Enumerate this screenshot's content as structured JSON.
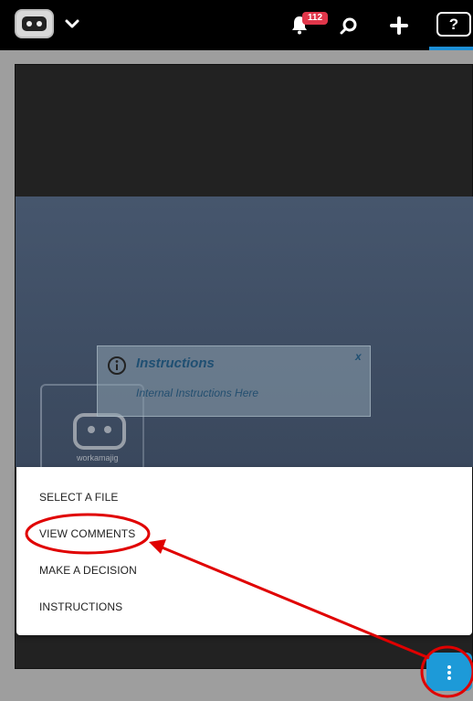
{
  "topbar": {
    "logo_icon": "robot-logo-icon",
    "menu_icon": "chevron-down-icon",
    "notifications": {
      "icon": "bell-icon",
      "count": "112"
    },
    "search_icon": "search-icon",
    "add_icon": "plus-icon",
    "help": {
      "icon": "help-icon",
      "label": "?"
    }
  },
  "viewer": {
    "watermark_text": "workamajig"
  },
  "instructions_popup": {
    "icon": "info-icon",
    "title": "Instructions",
    "close_label": "x",
    "body": "Internal Instructions Here"
  },
  "menu": {
    "items": [
      {
        "label": "SELECT A FILE"
      },
      {
        "label": "VIEW COMMENTS"
      },
      {
        "label": "MAKE A DECISION"
      },
      {
        "label": "INSTRUCTIONS"
      }
    ]
  },
  "fab": {
    "icon": "more-vertical-icon"
  },
  "annotations": {
    "color": "#e00000"
  },
  "colors": {
    "topbar": "#000000",
    "accent": "#1d9ad8",
    "badge": "#e0364a",
    "background": "#9e9e9e"
  }
}
